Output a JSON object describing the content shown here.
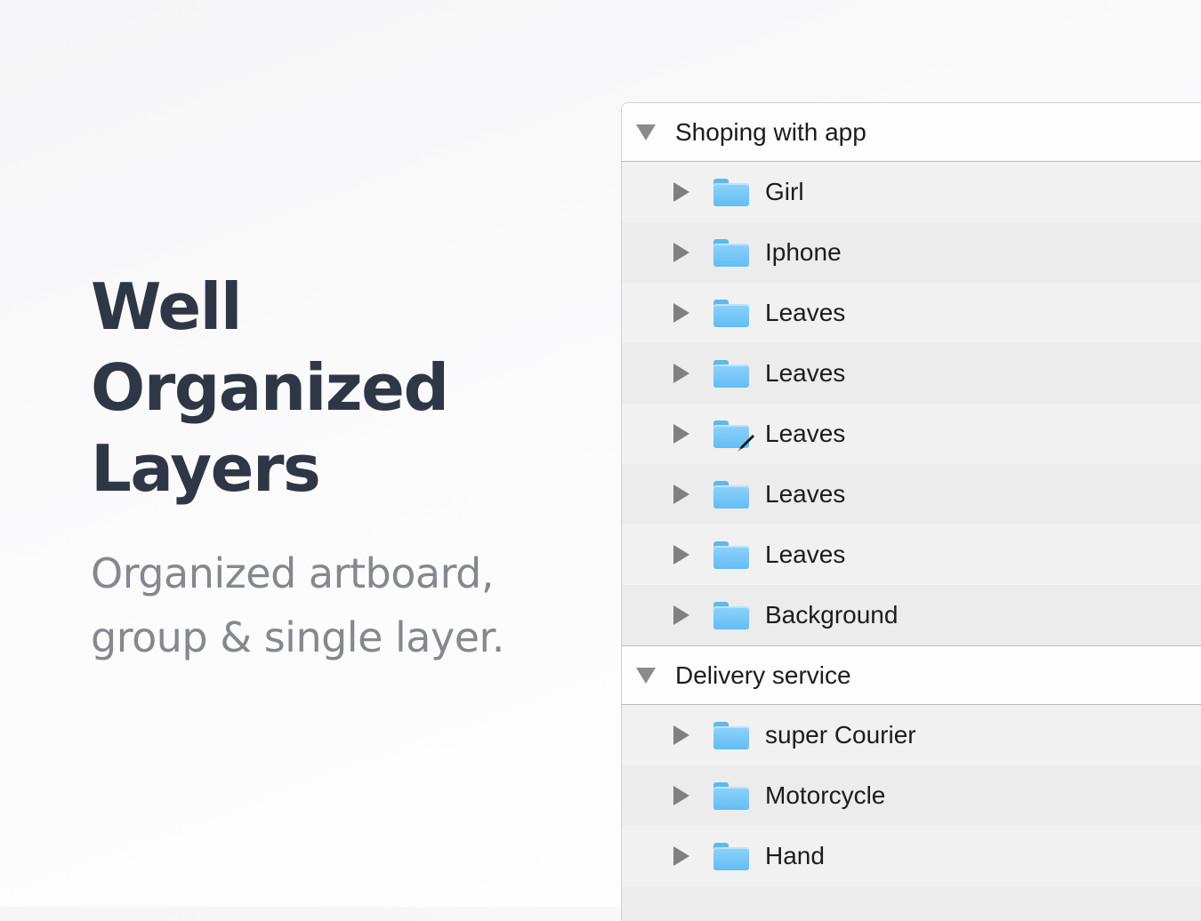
{
  "hero": {
    "title_line1": "Well Organized",
    "title_line2": "Layers",
    "subtitle_line1": "Organized artboard,",
    "subtitle_line2": "group & single layer."
  },
  "layers_panel": {
    "groups": [
      {
        "label": "Shoping with app",
        "expanded": true,
        "items": [
          {
            "label": "Girl",
            "icon": "folder-icon"
          },
          {
            "label": "Iphone",
            "icon": "folder-icon"
          },
          {
            "label": "Leaves",
            "icon": "folder-icon"
          },
          {
            "label": "Leaves",
            "icon": "folder-icon"
          },
          {
            "label": "Leaves",
            "icon": "folder-icon"
          },
          {
            "label": "Leaves",
            "icon": "folder-icon"
          },
          {
            "label": "Leaves",
            "icon": "folder-icon"
          },
          {
            "label": "Background",
            "icon": "folder-icon"
          }
        ]
      },
      {
        "label": "Delivery service",
        "expanded": true,
        "items": [
          {
            "label": "super Courier",
            "icon": "folder-icon"
          },
          {
            "label": "Motorcycle",
            "icon": "folder-icon"
          },
          {
            "label": "Hand",
            "icon": "folder-icon"
          }
        ]
      }
    ]
  },
  "colors": {
    "title": "#2f3747",
    "subtitle": "#868890",
    "folder": "#6cc1f6"
  }
}
